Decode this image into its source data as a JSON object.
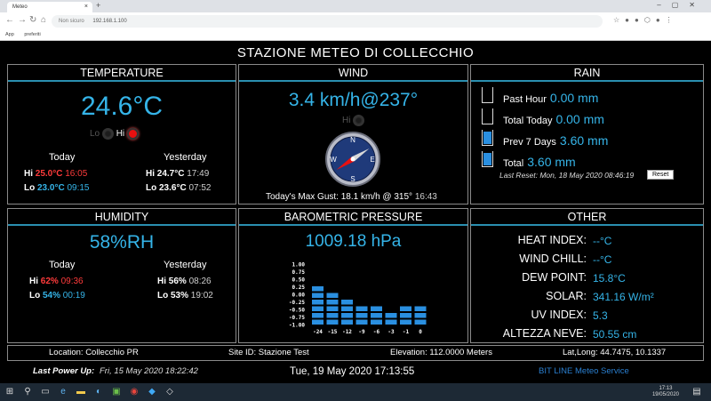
{
  "browser": {
    "tab_title": "Meteo",
    "url_prefix": "Non sicuro",
    "url": "192.168.1.100",
    "bookmarks": [
      "App",
      "preferiti"
    ]
  },
  "app": {
    "title": "STAZIONE METEO DI COLLECCHIO"
  },
  "temperature": {
    "header": "TEMPERATURE",
    "current": "24.6°C",
    "lo_label": "Lo",
    "hi_label": "Hi",
    "today_label": "Today",
    "yesterday_label": "Yesterday",
    "today_hi": "25.0°C",
    "today_hi_time": "16:05",
    "today_lo": "23.0°C",
    "today_lo_time": "09:15",
    "yest_hi": "24.7°C",
    "yest_hi_time": "17:49",
    "yest_lo": "23.6°C",
    "yest_lo_time": "07:52",
    "hi_row_label": "Hi",
    "lo_row_label": "Lo"
  },
  "wind": {
    "header": "WIND",
    "current": "3.4 km/h@237°",
    "hi_label": "Hi",
    "direction_deg": 237,
    "compass": {
      "n": "N",
      "e": "E",
      "s": "S",
      "w": "W"
    },
    "gust_label": "Today's Max Gust:",
    "gust_value": "18.1 km/h @ 315°",
    "gust_time": "16:43"
  },
  "rain": {
    "header": "RAIN",
    "rows": [
      {
        "label": "Past Hour",
        "value": "0.00 mm",
        "fill": 0
      },
      {
        "label": "Total Today",
        "value": "0.00 mm",
        "fill": 0
      },
      {
        "label": "Prev 7 Days",
        "value": "3.60 mm",
        "fill": 1
      },
      {
        "label": "Total",
        "value": "3.60 mm",
        "fill": 1
      }
    ],
    "last_reset": "Last Reset: Mon, 18 May 2020 08:46:19",
    "reset_button": "Reset"
  },
  "humidity": {
    "header": "HUMIDITY",
    "current": "58%RH",
    "today_label": "Today",
    "yesterday_label": "Yesterday",
    "hi_row_label": "Hi",
    "lo_row_label": "Lo",
    "today_hi": "62%",
    "today_hi_time": "09:36",
    "today_lo": "54%",
    "today_lo_time": "00:19",
    "yest_hi": "56%",
    "yest_hi_time": "08:26",
    "yest_lo": "53%",
    "yest_lo_time": "19:02"
  },
  "pressure": {
    "header": "BAROMETRIC PRESSURE",
    "current": "1009.18 hPa"
  },
  "chart_data": {
    "type": "bar",
    "categories": [
      "-24",
      "-15",
      "-12",
      "-9",
      "-6",
      "-3",
      "-1",
      "0"
    ],
    "values": [
      0.25,
      0.05,
      -0.1,
      -0.25,
      -0.4,
      -0.5,
      -0.4,
      -0.25
    ],
    "ylim": [
      -1.0,
      1.0
    ],
    "yticks": [
      "1.00",
      "0.75",
      "0.50",
      "0.25",
      "0.00",
      "-0.25",
      "-0.50",
      "-0.75",
      "-1.00"
    ],
    "bar_color": "#2a8fe0",
    "grid": false
  },
  "other": {
    "header": "OTHER",
    "rows": [
      {
        "label": "HEAT INDEX:",
        "value": "--°C"
      },
      {
        "label": "WIND CHILL:",
        "value": "--°C"
      },
      {
        "label": "DEW POINT:",
        "value": "15.8°C"
      },
      {
        "label": "SOLAR:",
        "value": "341.16 W/m²"
      },
      {
        "label": "UV INDEX:",
        "value": "5.3"
      },
      {
        "label": "ALTEZZA NEVE:",
        "value": "50.55 cm"
      }
    ]
  },
  "status": {
    "location": "Location: Collecchio PR",
    "site_id": "Site ID: Stazione Test",
    "elevation": "Elevation: 112.0000 Meters",
    "latlong": "Lat,Long: 44.7475, 10.1337"
  },
  "footer": {
    "power_label": "Last Power Up:",
    "power_value": "Fri, 15 May 2020 18:22:42",
    "datetime": "Tue, 19 May 2020 17:13:55",
    "service": "BIT LINE Meteo Service"
  },
  "taskbar": {
    "time": "17:13",
    "date": "19/05/2020"
  },
  "colors": {
    "accent": "#35b4e8",
    "hi": "#ff3b3b",
    "panel_rule": "#2a8fb0"
  }
}
